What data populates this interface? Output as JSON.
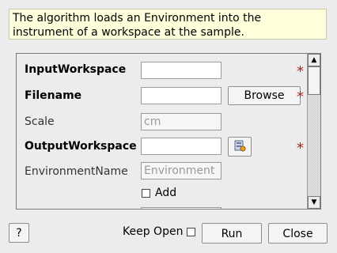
{
  "description": "The algorithm loads an Environment into the instrument of a workspace at the sample.",
  "form": {
    "input_workspace": {
      "label": "InputWorkspace",
      "value": ""
    },
    "filename": {
      "label": "Filename",
      "value": "",
      "browse_label": "Browse"
    },
    "scale": {
      "label": "Scale",
      "placeholder": "cm"
    },
    "output_workspace": {
      "label": "OutputWorkspace",
      "value": ""
    },
    "environment_name": {
      "label": "EnvironmentName",
      "placeholder": "Environment"
    },
    "add": {
      "label": "Add",
      "checked": false
    }
  },
  "required_marker": "*",
  "footer": {
    "help_label": "?",
    "keep_open_label": "Keep Open",
    "keep_open_checked": false,
    "run_label": "Run",
    "close_label": "Close"
  }
}
